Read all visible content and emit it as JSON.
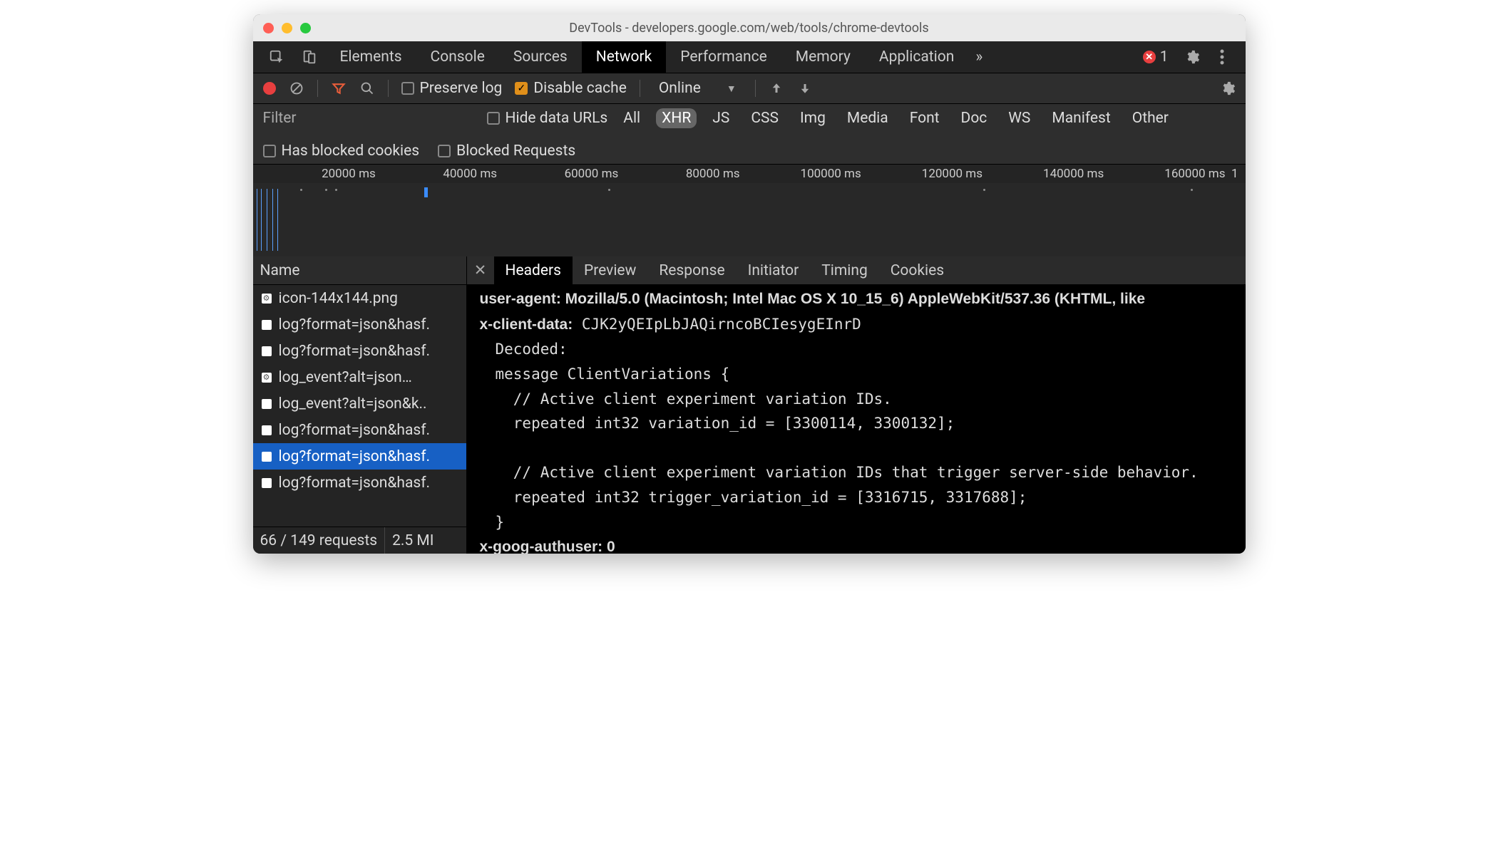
{
  "window": {
    "title": "DevTools - developers.google.com/web/tools/chrome-devtools"
  },
  "mainTabs": {
    "items": [
      "Elements",
      "Console",
      "Sources",
      "Network",
      "Performance",
      "Memory",
      "Application"
    ],
    "activeIndex": 3,
    "overflow": "»",
    "errorCount": "1"
  },
  "networkToolbar": {
    "preserveLog": {
      "label": "Preserve log",
      "checked": false
    },
    "disableCache": {
      "label": "Disable cache",
      "checked": true
    },
    "throttle": {
      "label": "Online"
    }
  },
  "filterBar": {
    "placeholder": "Filter",
    "hideDataUrls": "Hide data URLs",
    "types": [
      "All",
      "XHR",
      "JS",
      "CSS",
      "Img",
      "Media",
      "Font",
      "Doc",
      "WS",
      "Manifest",
      "Other"
    ],
    "activeType": "XHR",
    "hasBlockedCookies": "Has blocked cookies",
    "blockedRequests": "Blocked Requests"
  },
  "timeline": {
    "labels": [
      "20000 ms",
      "40000 ms",
      "60000 ms",
      "80000 ms",
      "100000 ms",
      "120000 ms",
      "140000 ms",
      "160000 ms",
      "1"
    ]
  },
  "requests": {
    "columnHeader": "Name",
    "items": [
      {
        "name": "icon-144x144.png",
        "type": "gear"
      },
      {
        "name": "log?format=json&hasf.",
        "type": "doc"
      },
      {
        "name": "log?format=json&hasf.",
        "type": "doc"
      },
      {
        "name": "log_event?alt=json…",
        "type": "gear"
      },
      {
        "name": "log_event?alt=json&k..",
        "type": "doc"
      },
      {
        "name": "log?format=json&hasf.",
        "type": "doc"
      },
      {
        "name": "log?format=json&hasf.",
        "type": "doc",
        "selected": true
      },
      {
        "name": "log?format=json&hasf.",
        "type": "doc"
      }
    ],
    "status": {
      "requests": "66 / 149 requests",
      "transfer": "2.5 MI"
    }
  },
  "detail": {
    "tabs": [
      "Headers",
      "Preview",
      "Response",
      "Initiator",
      "Timing",
      "Cookies"
    ],
    "activeIndex": 0,
    "headers": {
      "userAgentLine": "user-agent: Mozilla/5.0 (Macintosh; Intel Mac OS X 10_15_6) AppleWebKit/537.36 (KHTML, like",
      "xClientDataName": "x-client-data:",
      "xClientDataValue": "CJK2yQEIpLbJAQirncoBCIesygEInrD",
      "decodedLabel": "Decoded:",
      "decodedBody": "message ClientVariations {\n  // Active client experiment variation IDs.\n  repeated int32 variation_id = [3300114, 3300132];\n\n  // Active client experiment variation IDs that trigger server-side behavior.\n  repeated int32 trigger_variation_id = [3316715, 3317688];\n}",
      "xGoogLine": "x-goog-authuser: 0"
    }
  }
}
